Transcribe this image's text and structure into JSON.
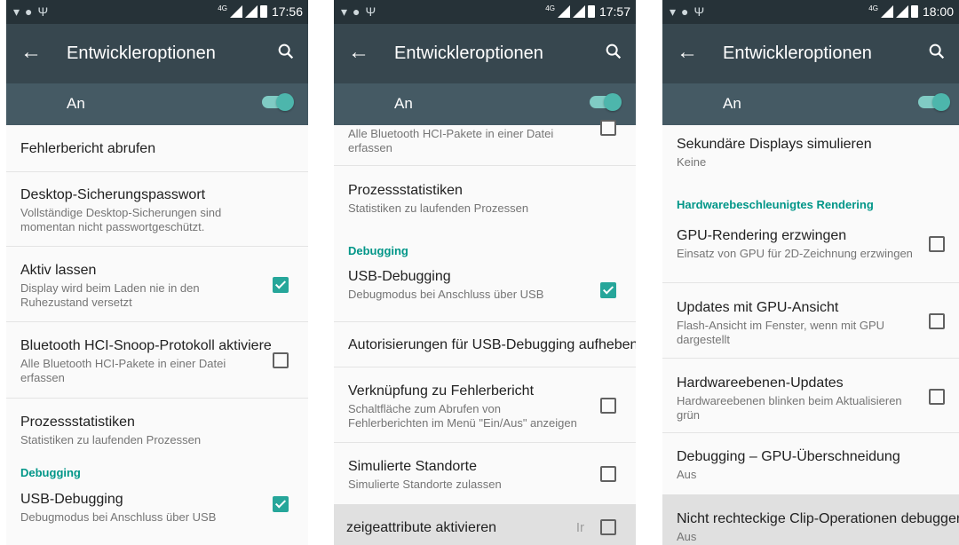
{
  "common": {
    "title": "Entwickleroptionen",
    "master_switch_label": "An"
  },
  "screens": [
    {
      "time": "17:56",
      "items": [
        {
          "title": "Fehlerbericht abrufen"
        },
        {
          "title": "Desktop-Sicherungspasswort",
          "summary": "Vollständige Desktop-Sicherungen sind momentan nicht passwortgeschützt."
        },
        {
          "title": "Aktiv lassen",
          "summary": "Display wird beim Laden nie in den Ruhezustand versetzt",
          "checked": true
        },
        {
          "title": "Bluetooth HCI-Snoop-Protokoll aktiviere",
          "summary": "Alle Bluetooth HCI-Pakete in einer Datei erfassen",
          "checked": false
        },
        {
          "title": "Prozessstatistiken",
          "summary": "Statistiken zu laufenden Prozessen"
        },
        {
          "section": "Debugging"
        },
        {
          "title": "USB-Debugging",
          "summary": "Debugmodus bei Anschluss über USB",
          "checked": true
        }
      ]
    },
    {
      "time": "17:57",
      "items": [
        {
          "summary": "Alle Bluetooth HCI-Pakete in einer Datei erfassen",
          "checked": false
        },
        {
          "title": "Prozessstatistiken",
          "summary": "Statistiken zu laufenden Prozessen"
        },
        {
          "section": "Debugging"
        },
        {
          "title": "USB-Debugging",
          "summary": "Debugmodus bei Anschluss über USB",
          "checked": true
        },
        {
          "title": "Autorisierungen für USB-Debugging aufheben"
        },
        {
          "title": "Verknüpfung zu Fehlerbericht",
          "summary": "Schaltfläche zum Abrufen von Fehlerberichten im Menü \"Ein/Aus\" anzeigen",
          "checked": false
        },
        {
          "title": "Simulierte Standorte",
          "summary": "Simulierte Standorte zulassen",
          "checked": false
        },
        {
          "title": "zeigeattribute aktivieren",
          "trailer": "Ir",
          "checked": false
        }
      ]
    },
    {
      "time": "18:00",
      "items": [
        {
          "title": "Sekundäre Displays simulieren",
          "summary": "Keine"
        },
        {
          "section": "Hardwarebeschleunigtes Rendering"
        },
        {
          "title": "GPU-Rendering erzwingen",
          "summary": "Einsatz von GPU für 2D-Zeichnung erzwingen",
          "checked": false
        },
        {
          "title": "Updates mit GPU-Ansicht",
          "summary": "Flash-Ansicht im Fenster, wenn mit GPU dargestellt",
          "checked": false
        },
        {
          "title": "Hardwareebenen-Updates",
          "summary": "Hardwareebenen blinken beim Aktualisieren grün",
          "checked": false
        },
        {
          "title": "Debugging – GPU-Überschneidung",
          "summary": "Aus"
        },
        {
          "title": "Nicht rechteckige Clip-Operationen debuggen",
          "summary": "Aus"
        }
      ]
    }
  ],
  "icons": [
    "back-arrow-icon",
    "search-icon",
    "wifi-icon",
    "android-icon",
    "usb-icon",
    "signal-icon",
    "battery-icon"
  ],
  "colors": {
    "accent": "#009688",
    "toolbar": "#37474f",
    "status_bar": "#263238",
    "switch_bar": "#455a64"
  }
}
